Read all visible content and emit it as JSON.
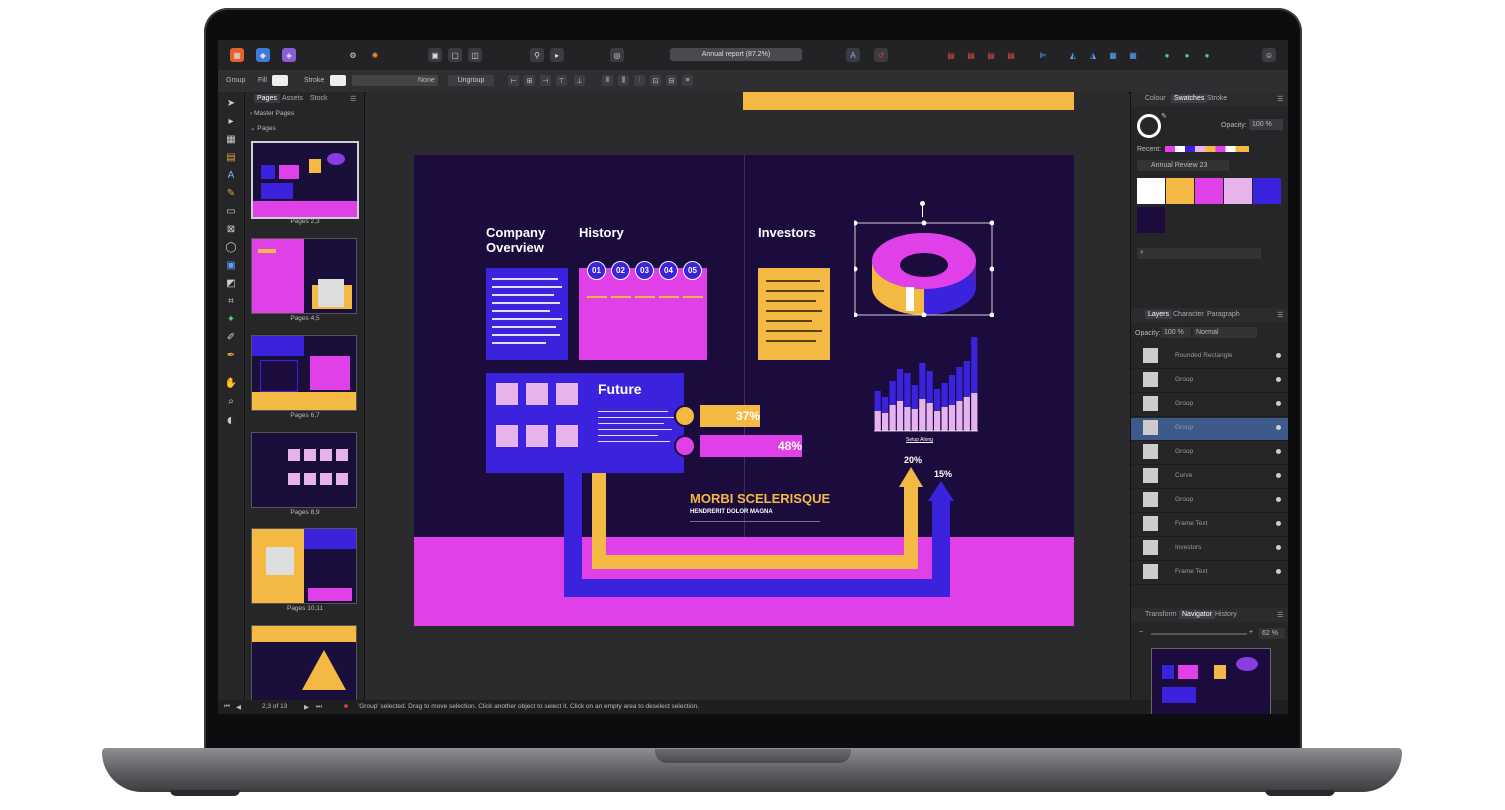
{
  "toolbar": {
    "progress_label": "Annual report (87.2%)"
  },
  "context_bar": {
    "group_label": "Group",
    "fill_label": "Fill",
    "stroke_label": "Stroke",
    "none_label": "None",
    "ungroup_label": "Ungroup"
  },
  "pages_panel": {
    "tabs": [
      "Pages",
      "Assets",
      "Stock"
    ],
    "master_pages_label": "Master Pages",
    "pages_label": "Pages",
    "thumbnails": [
      "Pages 2,3",
      "Pages 4,5",
      "Pages 6,7",
      "Pages 8,9",
      "Pages 10,11"
    ]
  },
  "document": {
    "company_overview": "Company\nOverview",
    "history": "History",
    "investors": "Investors",
    "future": "Future",
    "history_numbers": [
      "01",
      "02",
      "03",
      "04",
      "05"
    ],
    "bar_37": "37%",
    "bar_48": "48%",
    "headline": "MORBI SCELERISQUE",
    "subheadline": "HENDRERIT DOLOR MAGNA",
    "arrow_20": "20%",
    "arrow_15": "15%",
    "chart_caption": "Setup Along"
  },
  "status_bar": {
    "page_indicator": "2,3 of 13",
    "message": "'Group' selected. Drag to move selection. Click another object to select it. Click on an empty area to deselect selection."
  },
  "right_panel": {
    "top_tabs": [
      "Colour",
      "Swatches",
      "Stroke"
    ],
    "opacity_label": "Opacity:",
    "opacity_value": "100 %",
    "recent_label": "Recent:",
    "palette_name": "Annual Review 23",
    "swatch_colors": [
      "#ffffff",
      "#f4b942",
      "#e040e8",
      "#e6b3ec",
      "#3b22dc",
      "#1b0c3d"
    ],
    "layers_tabs": [
      "Layers",
      "Character",
      "Paragraph"
    ],
    "layers_opacity_label": "Opacity:",
    "layers_opacity_value": "100 %",
    "blend_mode": "Normal",
    "layers": [
      "Rounded Rectangle",
      "Group",
      "Group",
      "Group",
      "Group",
      "Curve",
      "Group",
      "Frame Text",
      "Investors",
      "Frame Text"
    ],
    "nav_tabs": [
      "Transform",
      "Navigator",
      "History"
    ],
    "zoom_value": "62 %"
  },
  "colors": {
    "purple_dark": "#1b0c3d",
    "blue": "#3b22dc",
    "magenta": "#e040e8",
    "yellow": "#f4b942",
    "pink_light": "#e6b3ec"
  }
}
